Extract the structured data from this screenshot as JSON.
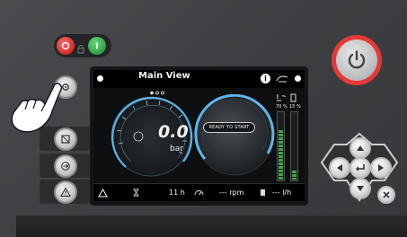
{
  "screen": {
    "title": "Main View",
    "page_indicator": {
      "total": 3,
      "active": 1
    },
    "info_icon": "info-icon",
    "status": "READY TO START",
    "pressure": {
      "value": "0.0",
      "unit": "bar"
    },
    "gauge_ticks": [
      "0",
      "10",
      "20",
      "30",
      "40",
      "50",
      "60",
      "70",
      "80",
      "90",
      "100",
      "125",
      "150",
      "200"
    ],
    "gauge_max_label": "max",
    "temp_label": "70 %",
    "fuel_label": "15 %",
    "bottom": {
      "hours": "11 h",
      "rpm": "--- rpm",
      "fuel_rate": "--- l/h"
    }
  },
  "colors": {
    "panel": "#3d3f42",
    "accent_blue": "#5fb5e8",
    "bar_green": "#4caf50",
    "power_ring": "#e53935",
    "stop_button": "#e53935",
    "start_button": "#2e9e44"
  },
  "icons": {
    "stop": "power-off-icon",
    "start": "power-on-icon",
    "side_buttons": [
      "settings-icon",
      "display-icon",
      "login-icon",
      "warning-icon"
    ],
    "power": "power-icon",
    "dpad": [
      "up-icon",
      "left-icon",
      "enter-icon",
      "right-icon",
      "down-icon",
      "close-icon"
    ]
  }
}
